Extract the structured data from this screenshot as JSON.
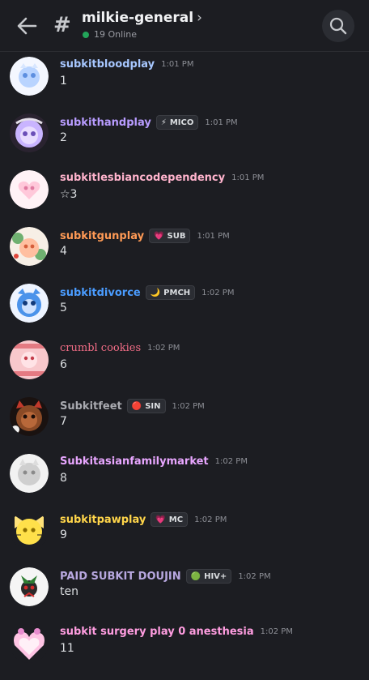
{
  "header": {
    "hash_icon": "#",
    "channel": "milkie-general",
    "chevron": "›",
    "online": "19 Online",
    "colors": {
      "online_dot": "#23a55a"
    }
  },
  "messages": [
    {
      "username": "subkitbloodplay",
      "color": "#a7c7ff",
      "tag_icon": "",
      "tag": "",
      "time": "1:01 PM",
      "text": "1",
      "avatar": "av-blue-light"
    },
    {
      "username": "subkithandplay",
      "color": "#b89cff",
      "tag_icon": "⚡",
      "tag": "MICO",
      "time": "1:01 PM",
      "text": "2",
      "avatar": "av-purple"
    },
    {
      "username": "subkitlesbiancodependency",
      "color": "#ffb3cc",
      "tag_icon": "",
      "tag": "",
      "time": "1:01 PM",
      "text": "☆3",
      "avatar": "av-pink-light"
    },
    {
      "username": "subkitgunplay",
      "color": "#ff9a55",
      "tag_icon": "💗",
      "tag": "SUB",
      "time": "1:01 PM",
      "text": "4",
      "avatar": "av-green-peach"
    },
    {
      "username": "subkitdivorce",
      "color": "#4a9cff",
      "tag_icon": "🌙",
      "tag": "PMCH",
      "time": "1:02 PM",
      "text": "5",
      "avatar": "av-blue"
    },
    {
      "username": "crumbl cookies",
      "color": "#f26d86",
      "tag_icon": "",
      "tag": "",
      "time": "1:02 PM",
      "text": "6",
      "avatar": "av-pink-red"
    },
    {
      "username": "Subkitfeet",
      "color": "#a9aab0",
      "tag_icon": "🔴",
      "tag": "SIN",
      "time": "1:02 PM",
      "text": "7",
      "avatar": "av-dark-brown"
    },
    {
      "username": "Subkitasianfamilymarket",
      "color": "#e8a6ff",
      "tag_icon": "",
      "tag": "",
      "time": "1:02 PM",
      "text": "8",
      "avatar": "av-grey"
    },
    {
      "username": "subkitpawplay",
      "color": "#ffd54a",
      "tag_icon": "💗",
      "tag": "MC",
      "time": "1:02 PM",
      "text": "9",
      "avatar": "av-yellow"
    },
    {
      "username": "PAID SUBKIT DOUJIN",
      "color": "#b8a8e0",
      "tag_icon": "🟢",
      "tag": "HIV+",
      "time": "1:02 PM",
      "text": "ten",
      "avatar": "av-white-red"
    },
    {
      "username": "subkit surgery play 0 anesthesia",
      "color": "#ff9de0",
      "tag_icon": "",
      "tag": "",
      "time": "1:02 PM",
      "text": "11",
      "avatar": "av-pink-frame"
    }
  ]
}
